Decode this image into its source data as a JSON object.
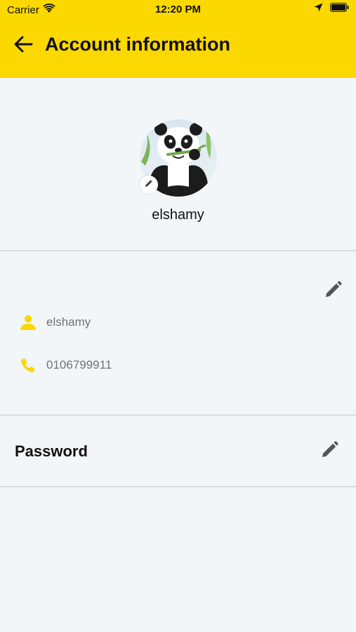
{
  "status_bar": {
    "carrier": "Carrier",
    "time": "12:20 PM"
  },
  "header": {
    "title": "Account information",
    "back_icon": "arrow-left-icon"
  },
  "profile": {
    "name": "elshamy",
    "avatar_icon": "panda-avatar"
  },
  "account_info": {
    "username": "elshamy",
    "phone": "0106799911",
    "username_icon": "person-icon",
    "phone_icon": "phone-icon",
    "edit_icon": "pencil-icon"
  },
  "password": {
    "label": "Password",
    "edit_icon": "pencil-icon"
  },
  "colors": {
    "accent": "#fbd800",
    "background": "#f2f6f9",
    "divider": "#d9dcdf",
    "muted_text": "#6f7377",
    "icon_yellow": "#fbd800",
    "pencil": "#555555"
  }
}
